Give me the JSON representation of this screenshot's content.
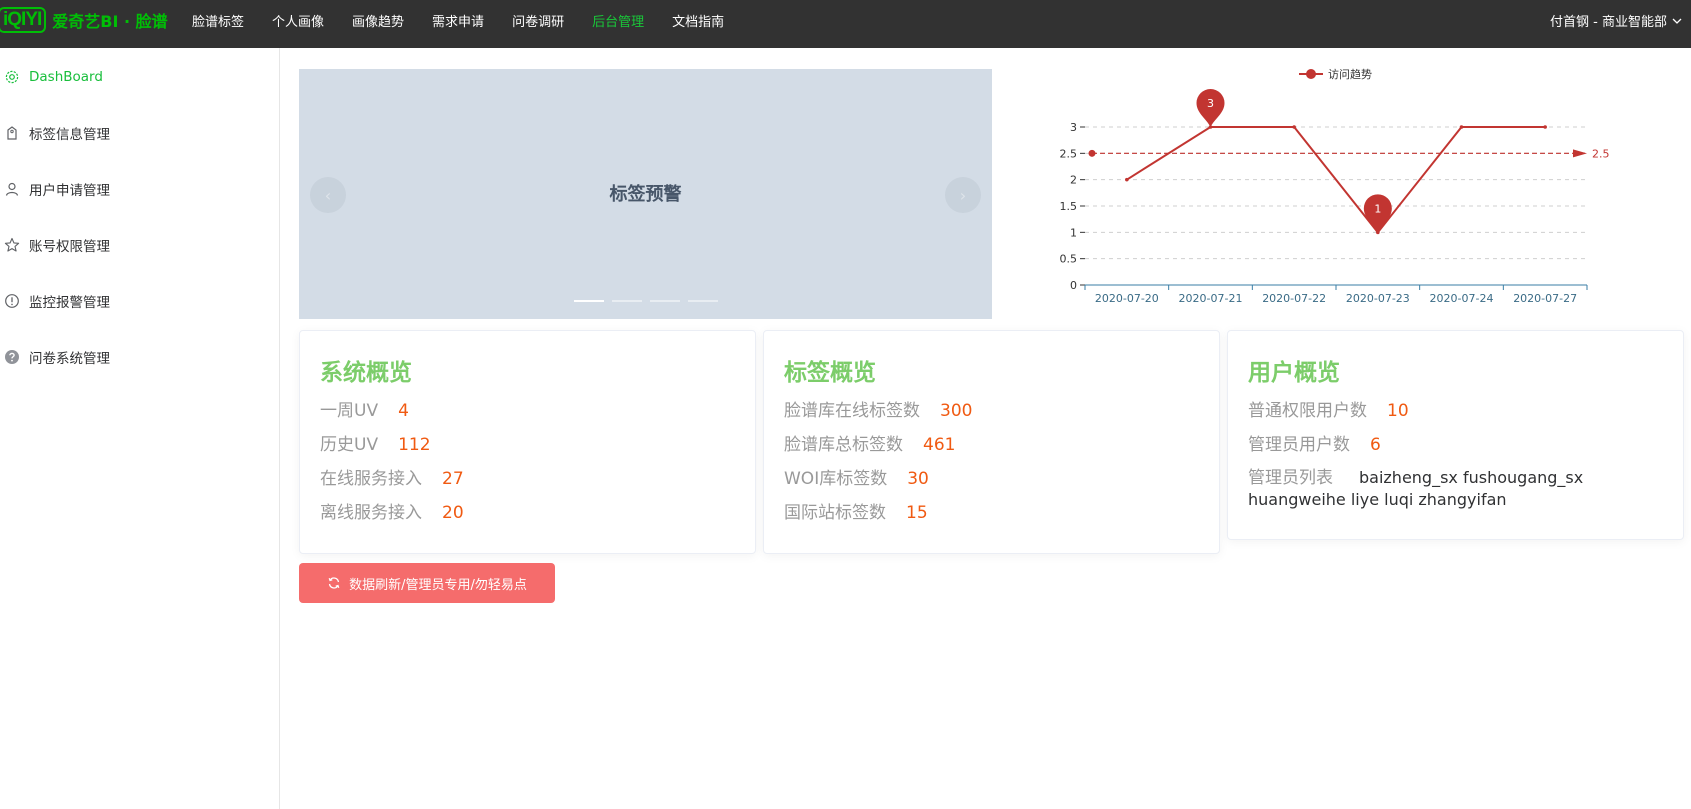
{
  "brand": {
    "logo": "iQIYI",
    "name": "爱奇艺BI · 脸谱"
  },
  "nav": {
    "items": [
      "脸谱标签",
      "个人画像",
      "画像趋势",
      "需求申请",
      "问卷调研",
      "后台管理",
      "文档指南"
    ],
    "active_index": 5
  },
  "user_menu": {
    "label": "付首钢 - 商业智能部",
    "icon": "chevron-down-icon"
  },
  "sidebar": {
    "items": [
      {
        "label": "DashBoard",
        "icon": "gear-icon",
        "active": true
      },
      {
        "label": "标签信息管理",
        "icon": "tag-icon",
        "active": false
      },
      {
        "label": "用户申请管理",
        "icon": "user-icon",
        "active": false
      },
      {
        "label": "账号权限管理",
        "icon": "star-icon",
        "active": false
      },
      {
        "label": "监控报警管理",
        "icon": "warning-icon",
        "active": false
      },
      {
        "label": "问卷系统管理",
        "icon": "question-icon",
        "active": false
      }
    ]
  },
  "carousel": {
    "title": "标签预警",
    "slide_count": 4,
    "active_slide": 0,
    "prev_icon": "chevron-left-icon",
    "next_icon": "chevron-right-icon"
  },
  "colors": {
    "brand_green": "#00be06",
    "active_green": "#19be3c",
    "card_title_green": "#7ccd6a",
    "value_orange": "#f05a12",
    "series_red": "#c23531",
    "refresh_red": "#f56c6c",
    "topbar": "#323232"
  },
  "chart_data": {
    "type": "line",
    "x": [
      "2020-07-20",
      "2020-07-21",
      "2020-07-22",
      "2020-07-23",
      "2020-07-24",
      "2020-07-27"
    ],
    "series": [
      {
        "name": "访问趋势",
        "values": [
          2,
          3,
          3,
          1,
          3,
          3
        ]
      }
    ],
    "ylim": [
      0,
      3
    ],
    "yticks": [
      "0",
      "0.5",
      "1",
      "1.5",
      "2",
      "2.5",
      "3"
    ],
    "mark_points": [
      {
        "label": "3",
        "x": "2020-07-21",
        "y": 3
      },
      {
        "label": "1",
        "x": "2020-07-23",
        "y": 1
      }
    ],
    "mark_line": {
      "label": "2.5",
      "y": 2.5
    },
    "legend": "top-center",
    "grid": true
  },
  "cards": {
    "system": {
      "title": "系统概览",
      "rows": [
        {
          "label": "一周UV",
          "value": "4"
        },
        {
          "label": "历史UV",
          "value": "112"
        },
        {
          "label": "在线服务接入",
          "value": "27"
        },
        {
          "label": "离线服务接入",
          "value": "20"
        }
      ]
    },
    "tags": {
      "title": "标签概览",
      "rows": [
        {
          "label": "脸谱库在线标签数",
          "value": "300"
        },
        {
          "label": "脸谱库总标签数",
          "value": "461"
        },
        {
          "label": "WOI库标签数",
          "value": "30"
        },
        {
          "label": "国际站标签数",
          "value": "15"
        }
      ]
    },
    "users": {
      "title": "用户概览",
      "rows": [
        {
          "label": "普通权限用户数",
          "value": "10"
        },
        {
          "label": "管理员用户数",
          "value": "6"
        }
      ],
      "admin_label": "管理员列表",
      "admin_list": "baizheng_sx fushougang_sx huangweihe liye luqi zhangyifan"
    }
  },
  "refresh_button": {
    "label": "数据刷新/管理员专用/勿轻易点",
    "icon": "refresh-icon"
  }
}
